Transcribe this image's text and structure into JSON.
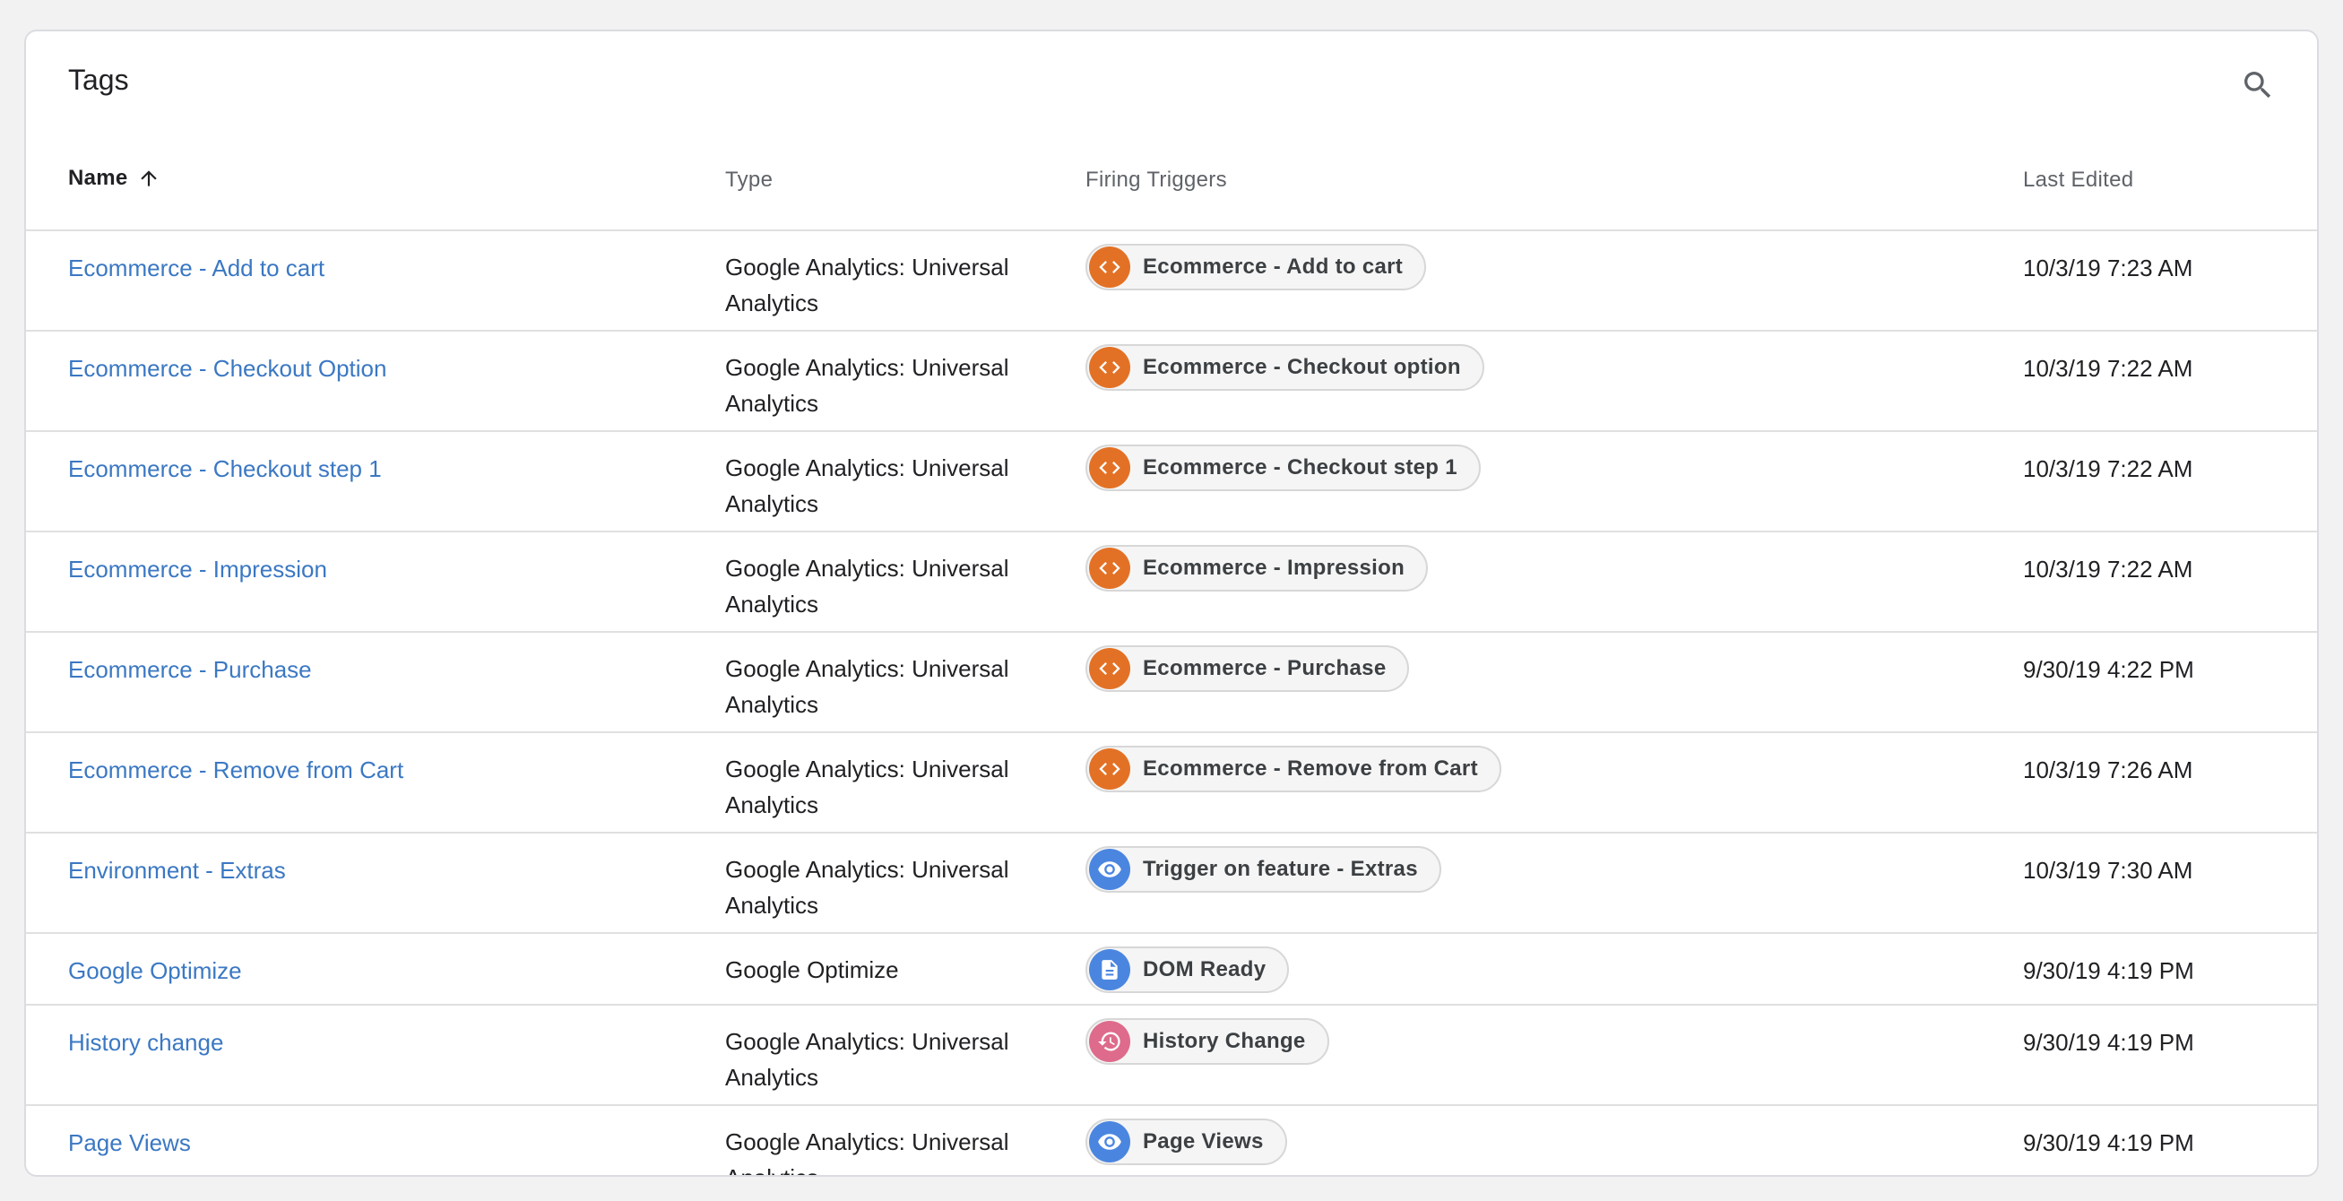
{
  "card": {
    "title": "Tags"
  },
  "colors": {
    "link": "#3b78c3",
    "custom_event": "#e37125",
    "page_view": "#4a86e0",
    "dom_ready": "#4a86e0",
    "history": "#de6b8b"
  },
  "table": {
    "headers": {
      "name": "Name",
      "type": "Type",
      "triggers": "Firing Triggers",
      "last_edited": "Last Edited"
    },
    "rows": [
      {
        "name": "Ecommerce - Add to cart",
        "type": "Google Analytics: Universal Analytics",
        "trigger": {
          "label": "Ecommerce - Add to cart",
          "icon": "code-icon"
        },
        "last_edited": "10/3/19 7:23 AM"
      },
      {
        "name": "Ecommerce - Checkout Option",
        "type": "Google Analytics: Universal Analytics",
        "trigger": {
          "label": "Ecommerce - Checkout option",
          "icon": "code-icon"
        },
        "last_edited": "10/3/19 7:22 AM"
      },
      {
        "name": "Ecommerce - Checkout step 1",
        "type": "Google Analytics: Universal Analytics",
        "trigger": {
          "label": "Ecommerce - Checkout step 1",
          "icon": "code-icon"
        },
        "last_edited": "10/3/19 7:22 AM"
      },
      {
        "name": "Ecommerce - Impression",
        "type": "Google Analytics: Universal Analytics",
        "trigger": {
          "label": "Ecommerce - Impression",
          "icon": "code-icon"
        },
        "last_edited": "10/3/19 7:22 AM"
      },
      {
        "name": "Ecommerce - Purchase",
        "type": "Google Analytics: Universal Analytics",
        "trigger": {
          "label": "Ecommerce - Purchase",
          "icon": "code-icon"
        },
        "last_edited": "9/30/19 4:22 PM"
      },
      {
        "name": "Ecommerce - Remove from Cart",
        "type": "Google Analytics: Universal Analytics",
        "trigger": {
          "label": "Ecommerce - Remove from Cart",
          "icon": "code-icon"
        },
        "last_edited": "10/3/19 7:26 AM"
      },
      {
        "name": "Environment - Extras",
        "type": "Google Analytics: Universal Analytics",
        "trigger": {
          "label": "Trigger on feature - Extras",
          "icon": "eye-icon"
        },
        "last_edited": "10/3/19 7:30 AM"
      },
      {
        "name": "Google Optimize",
        "type": "Google Optimize",
        "trigger": {
          "label": "DOM Ready",
          "icon": "document-icon"
        },
        "last_edited": "9/30/19 4:19 PM"
      },
      {
        "name": "History change",
        "type": "Google Analytics: Universal Analytics",
        "trigger": {
          "label": "History Change",
          "icon": "history-icon"
        },
        "last_edited": "9/30/19 4:19 PM"
      },
      {
        "name": "Page Views",
        "type": "Google Analytics: Universal Analytics",
        "trigger": {
          "label": "Page Views",
          "icon": "eye-icon"
        },
        "last_edited": "9/30/19 4:19 PM"
      }
    ]
  }
}
